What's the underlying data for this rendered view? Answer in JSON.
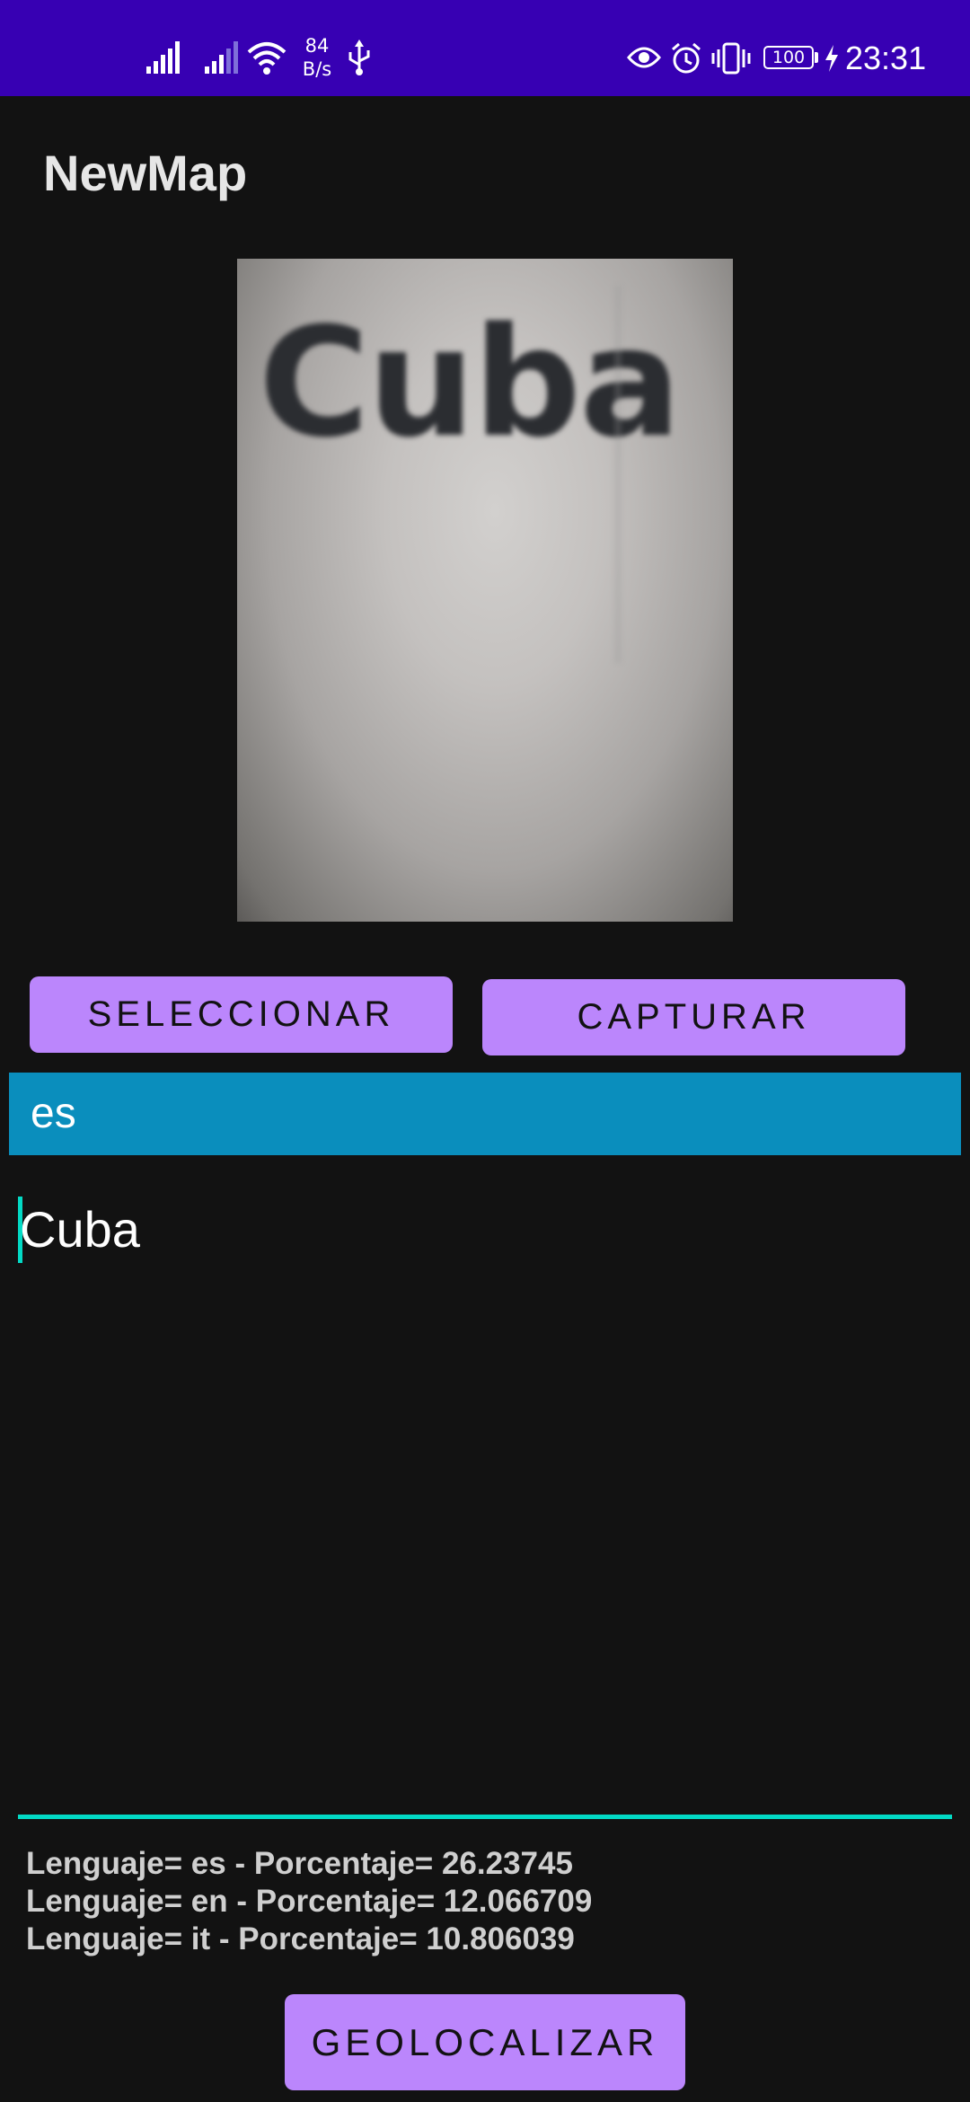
{
  "status_bar": {
    "net_speed_value": "84",
    "net_speed_unit": "B/s",
    "battery_level": "100",
    "time": "23:31",
    "icons": [
      "signal-icon",
      "signal-icon",
      "wifi-icon",
      "usb-icon",
      "eye-icon",
      "alarm-icon",
      "vibrate-icon",
      "battery-icon",
      "charging-icon"
    ]
  },
  "app": {
    "title": "NewMap"
  },
  "preview": {
    "photo_text": "Cuba"
  },
  "buttons": {
    "select_label": "SELECCIONAR",
    "capture_label": "CAPTURAR",
    "geolocate_label": "GEOLOCALIZAR"
  },
  "language": {
    "detected_code": "es"
  },
  "text_field": {
    "value": "Cuba"
  },
  "results": [
    "Lenguaje= es - Porcentaje= 26.23745",
    "Lenguaje= en - Porcentaje= 12.066709",
    "Lenguaje= it - Porcentaje= 10.806039"
  ],
  "colors": {
    "status_bar": "#3700b3",
    "background": "#121212",
    "button": "#bb86fc",
    "banner": "#0a8ebd",
    "accent": "#03dac5"
  }
}
